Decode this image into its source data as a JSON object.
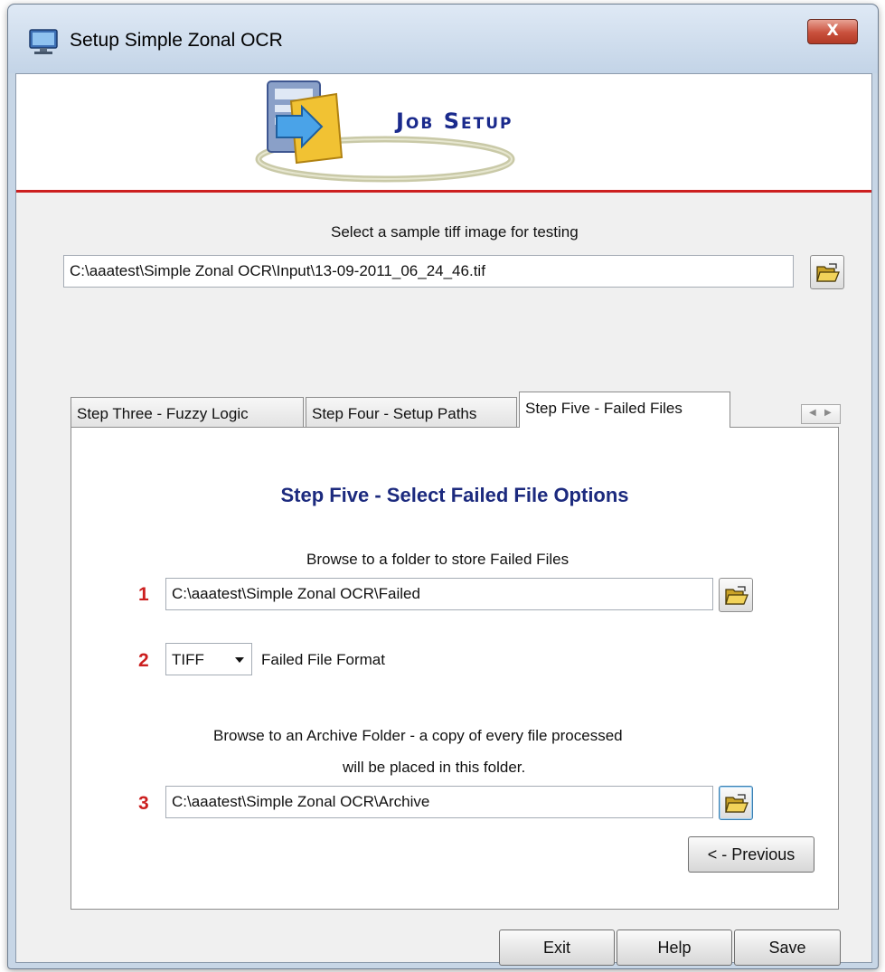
{
  "window": {
    "title": "Setup Simple Zonal OCR",
    "close_label": "X"
  },
  "header": {
    "title": "Job Setup"
  },
  "sample_image": {
    "label": "Select a sample tiff image for testing",
    "path": "C:\\aaatest\\Simple Zonal OCR\\Input\\13-09-2011_06_24_46.tif"
  },
  "tabs": [
    {
      "label": "Step Three - Fuzzy Logic",
      "active": false
    },
    {
      "label": "Step Four - Setup Paths",
      "active": false
    },
    {
      "label": "Step Five - Failed Files",
      "active": true
    }
  ],
  "tab_scroll": {
    "left": "◀",
    "right": "▶"
  },
  "panel": {
    "heading": "Step Five - Select Failed File Options",
    "failed_folder": {
      "number": "1",
      "label": "Browse to a folder to store Failed Files",
      "path": "C:\\aaatest\\Simple Zonal OCR\\Failed"
    },
    "format": {
      "number": "2",
      "value": "TIFF",
      "label": "Failed File Format"
    },
    "archive": {
      "number": "3",
      "label_line1": "Browse to an Archive Folder - a copy of every file processed",
      "label_line2": "will be placed in this folder.",
      "path": "C:\\aaatest\\Simple Zonal OCR\\Archive"
    },
    "previous_label": "< - Previous"
  },
  "footer": {
    "exit_label": "Exit",
    "help_label": "Help",
    "save_label": "Save"
  }
}
